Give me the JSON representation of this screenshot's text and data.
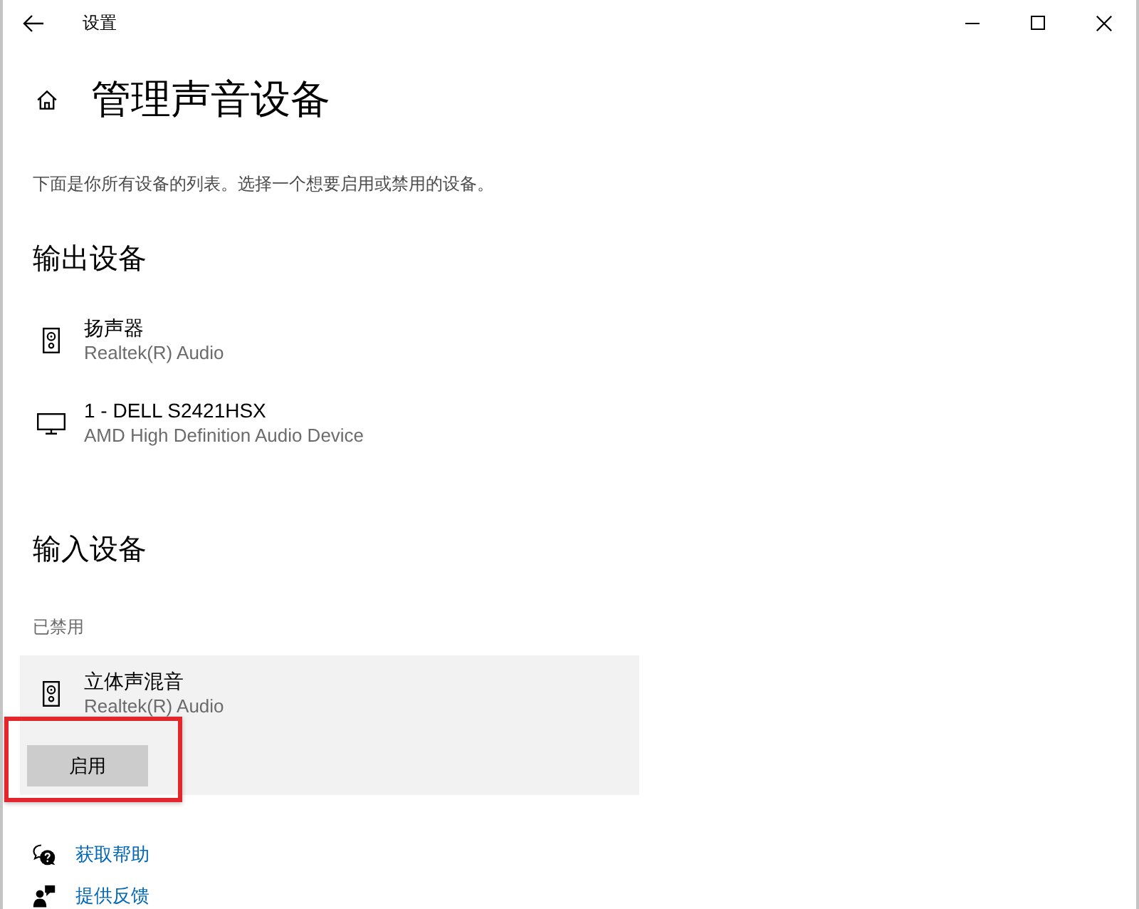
{
  "window": {
    "title": "设置"
  },
  "page": {
    "title": "管理声音设备",
    "description": "下面是你所有设备的列表。选择一个想要启用或禁用的设备。"
  },
  "output_devices": {
    "heading": "输出设备",
    "items": [
      {
        "kind": "speaker",
        "name": "扬声器",
        "driver": "Realtek(R) Audio",
        "selected": false
      },
      {
        "kind": "monitor",
        "name": "1 - DELL S2421HSX",
        "driver": "AMD High Definition Audio Device",
        "selected": false
      }
    ]
  },
  "input_devices": {
    "heading": "输入设备",
    "status_label": "已禁用",
    "items": [
      {
        "kind": "speaker",
        "name": "立体声混音",
        "driver": "Realtek(R) Audio",
        "selected": true,
        "action": "启用",
        "action_highlighted": true
      }
    ]
  },
  "links": [
    {
      "kind": "help",
      "label": "获取帮助"
    },
    {
      "kind": "feedback",
      "label": "提供反馈"
    }
  ]
}
